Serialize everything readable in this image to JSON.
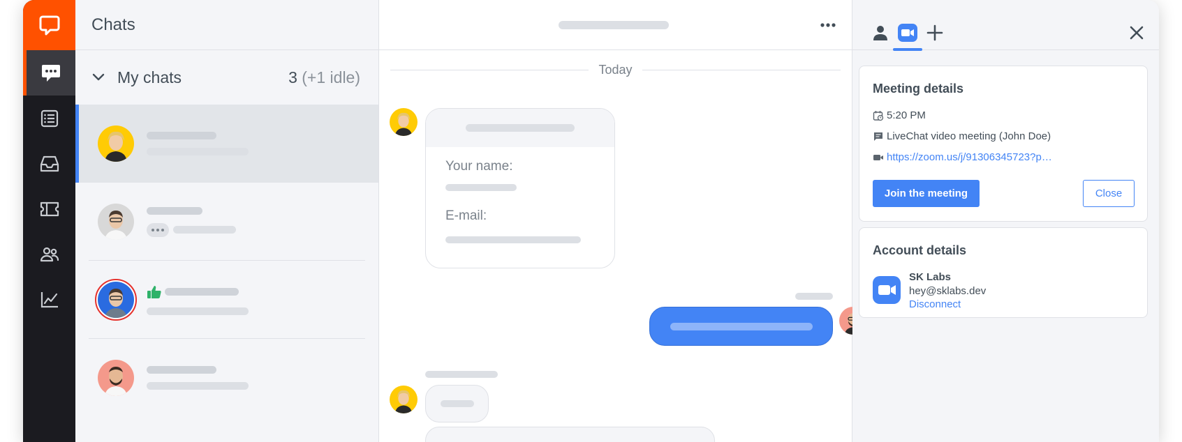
{
  "app": {
    "brand_color": "#ff5100",
    "accent": "#4384f5"
  },
  "nav": {
    "items": [
      {
        "icon": "chats-icon",
        "active": true
      },
      {
        "icon": "archives-icon"
      },
      {
        "icon": "inbox-icon"
      },
      {
        "icon": "tickets-icon"
      },
      {
        "icon": "customers-icon"
      },
      {
        "icon": "reports-icon"
      }
    ]
  },
  "chats_list": {
    "title": "Chats",
    "section": {
      "label": "My chats",
      "count": "3",
      "idle": "(+1 idle)"
    }
  },
  "conversation": {
    "day_divider": "Today",
    "form": {
      "name_label": "Your name:",
      "email_label": "E-mail:"
    }
  },
  "details_panel": {
    "meeting": {
      "title": "Meeting details",
      "time": "5:20 PM",
      "topic": "LiveChat video meeting (John Doe)",
      "link": "https://zoom.us/j/91306345723?p…",
      "join_label": "Join the meeting",
      "close_label": "Close"
    },
    "account": {
      "title": "Account details",
      "name": "SK Labs",
      "email": "hey@sklabs.dev",
      "disconnect_label": "Disconnect"
    }
  }
}
